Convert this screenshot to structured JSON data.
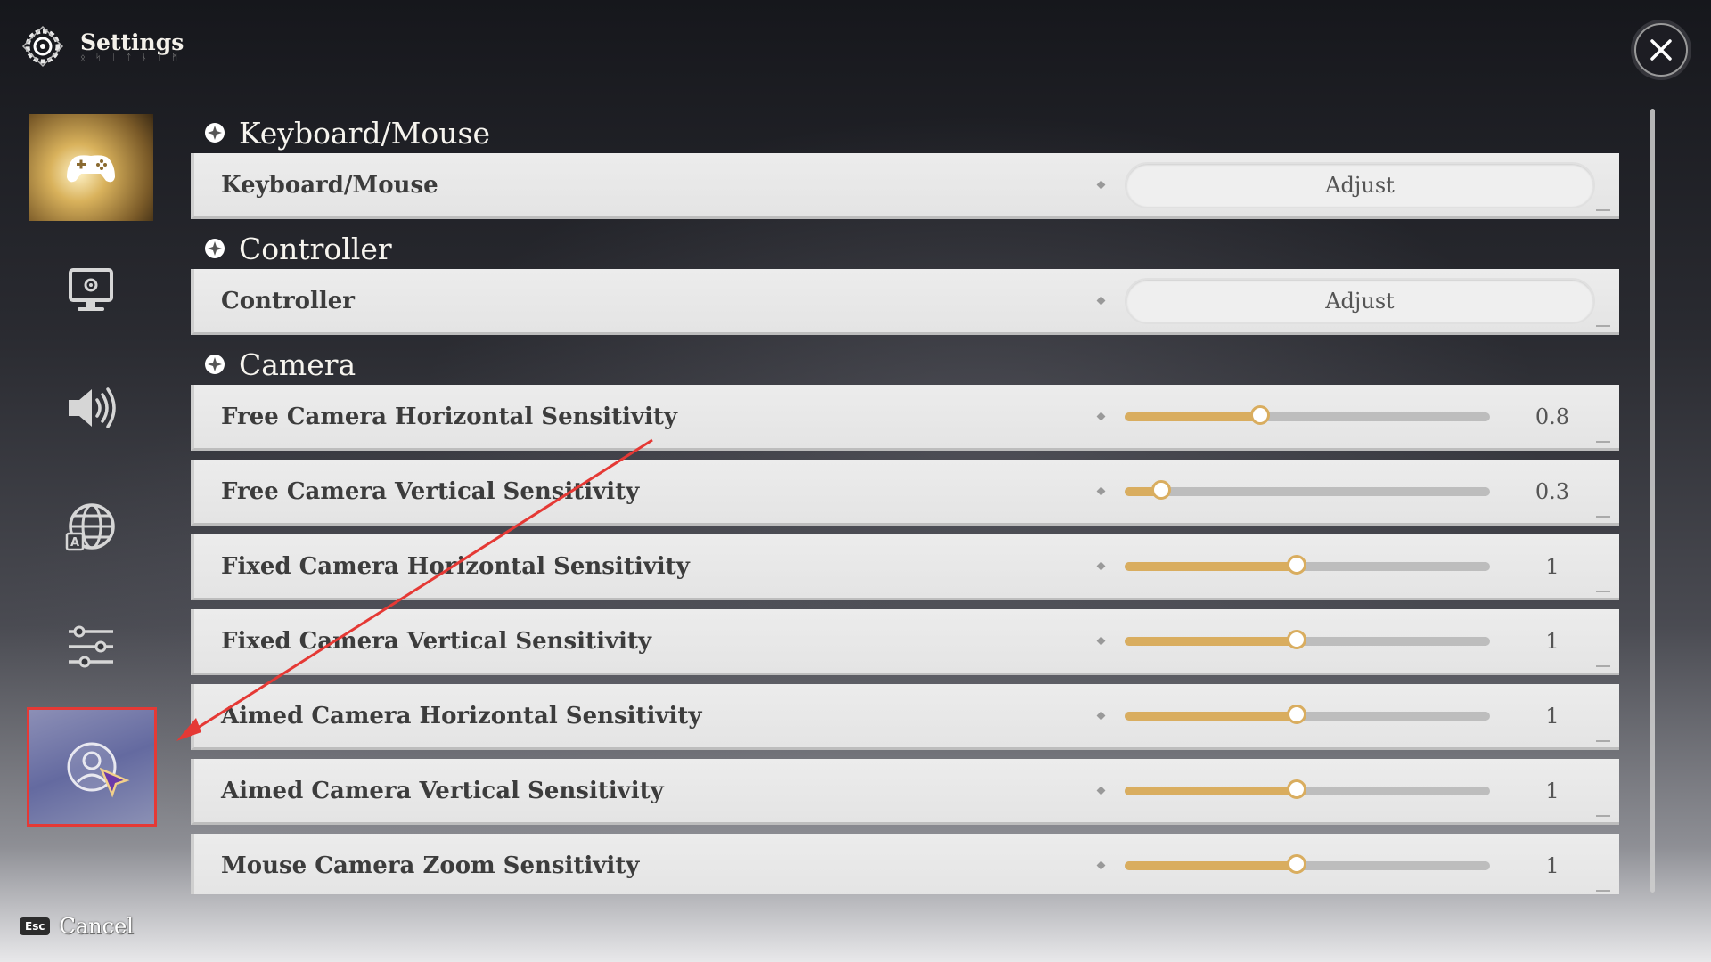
{
  "header": {
    "title": "Settings",
    "subtitle_runes": "ᛟ ᛋ ᛁ ᛏ ᚾ ᛁ ᛗ",
    "close_icon": "close-icon"
  },
  "nav": {
    "items": [
      {
        "name": "controls",
        "icon": "gamepad-icon",
        "active": true
      },
      {
        "name": "graphics",
        "icon": "monitor-gear-icon"
      },
      {
        "name": "audio",
        "icon": "speaker-icon"
      },
      {
        "name": "language",
        "icon": "globe-language-icon"
      },
      {
        "name": "other",
        "icon": "sliders-icon"
      },
      {
        "name": "account",
        "icon": "user-circle-icon",
        "highlighted": true
      }
    ]
  },
  "sections": {
    "keyboard": {
      "title": "Keyboard/Mouse",
      "row_label": "Keyboard/Mouse",
      "button": "Adjust"
    },
    "controller": {
      "title": "Controller",
      "row_label": "Controller",
      "button": "Adjust"
    },
    "camera": {
      "title": "Camera",
      "rows": [
        {
          "label": "Free Camera Horizontal Sensitivity",
          "value": "0.8",
          "fill": 0.37
        },
        {
          "label": "Free Camera Vertical Sensitivity",
          "value": "0.3",
          "fill": 0.1
        },
        {
          "label": "Fixed Camera Horizontal Sensitivity",
          "value": "1",
          "fill": 0.47
        },
        {
          "label": "Fixed Camera Vertical Sensitivity",
          "value": "1",
          "fill": 0.47
        },
        {
          "label": "Aimed Camera Horizontal Sensitivity",
          "value": "1",
          "fill": 0.47
        },
        {
          "label": "Aimed Camera Vertical Sensitivity",
          "value": "1",
          "fill": 0.47
        },
        {
          "label": "Mouse Camera Zoom Sensitivity",
          "value": "1",
          "fill": 0.47
        }
      ]
    }
  },
  "footer": {
    "esc_key": "Esc",
    "cancel_label": "Cancel"
  },
  "colors": {
    "accent": "#d9ad5f",
    "annotation": "#e53935",
    "row_bg": "#e8e8e8"
  }
}
